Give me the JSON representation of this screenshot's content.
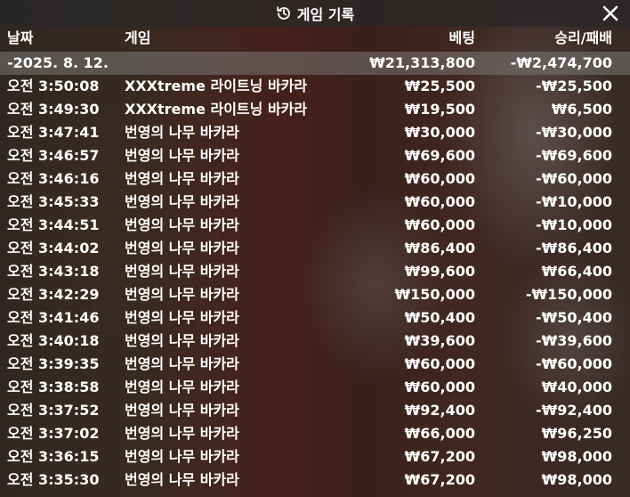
{
  "header": {
    "title": "게임 기록",
    "history_icon": "history-clock-icon",
    "close_icon": "close-icon"
  },
  "columns": {
    "date": "날짜",
    "game": "게임",
    "bet": "베팅",
    "win_loss": "승리/패배"
  },
  "summary": {
    "date": "-2025. 8. 12.",
    "bet": "₩21,313,800",
    "win_loss": "-₩2,474,700"
  },
  "rows": [
    {
      "time": "오전 3:50:08",
      "game": "XXXtreme 라이트닝 바카라",
      "bet": "₩25,500",
      "win_loss": "-₩25,500"
    },
    {
      "time": "오전 3:49:30",
      "game": "XXXtreme 라이트닝 바카라",
      "bet": "₩19,500",
      "win_loss": "₩6,500"
    },
    {
      "time": "오전 3:47:41",
      "game": "번영의 나무 바카라",
      "bet": "₩30,000",
      "win_loss": "-₩30,000"
    },
    {
      "time": "오전 3:46:57",
      "game": "번영의 나무 바카라",
      "bet": "₩69,600",
      "win_loss": "-₩69,600"
    },
    {
      "time": "오전 3:46:16",
      "game": "번영의 나무 바카라",
      "bet": "₩60,000",
      "win_loss": "-₩60,000"
    },
    {
      "time": "오전 3:45:33",
      "game": "번영의 나무 바카라",
      "bet": "₩60,000",
      "win_loss": "-₩10,000"
    },
    {
      "time": "오전 3:44:51",
      "game": "번영의 나무 바카라",
      "bet": "₩60,000",
      "win_loss": "-₩10,000"
    },
    {
      "time": "오전 3:44:02",
      "game": "번영의 나무 바카라",
      "bet": "₩86,400",
      "win_loss": "-₩86,400"
    },
    {
      "time": "오전 3:43:18",
      "game": "번영의 나무 바카라",
      "bet": "₩99,600",
      "win_loss": "₩66,400"
    },
    {
      "time": "오전 3:42:29",
      "game": "번영의 나무 바카라",
      "bet": "₩150,000",
      "win_loss": "-₩150,000"
    },
    {
      "time": "오전 3:41:46",
      "game": "번영의 나무 바카라",
      "bet": "₩50,400",
      "win_loss": "-₩50,400"
    },
    {
      "time": "오전 3:40:18",
      "game": "번영의 나무 바카라",
      "bet": "₩39,600",
      "win_loss": "-₩39,600"
    },
    {
      "time": "오전 3:39:35",
      "game": "번영의 나무 바카라",
      "bet": "₩60,000",
      "win_loss": "-₩60,000"
    },
    {
      "time": "오전 3:38:58",
      "game": "번영의 나무 바카라",
      "bet": "₩60,000",
      "win_loss": "₩40,000"
    },
    {
      "time": "오전 3:37:52",
      "game": "번영의 나무 바카라",
      "bet": "₩92,400",
      "win_loss": "-₩92,400"
    },
    {
      "time": "오전 3:37:02",
      "game": "번영의 나무 바카라",
      "bet": "₩66,000",
      "win_loss": "₩96,250"
    },
    {
      "time": "오전 3:36:15",
      "game": "번영의 나무 바카라",
      "bet": "₩67,200",
      "win_loss": "₩98,000"
    },
    {
      "time": "오전 3:35:30",
      "game": "번영의 나무 바카라",
      "bet": "₩67,200",
      "win_loss": "₩98,000"
    }
  ]
}
